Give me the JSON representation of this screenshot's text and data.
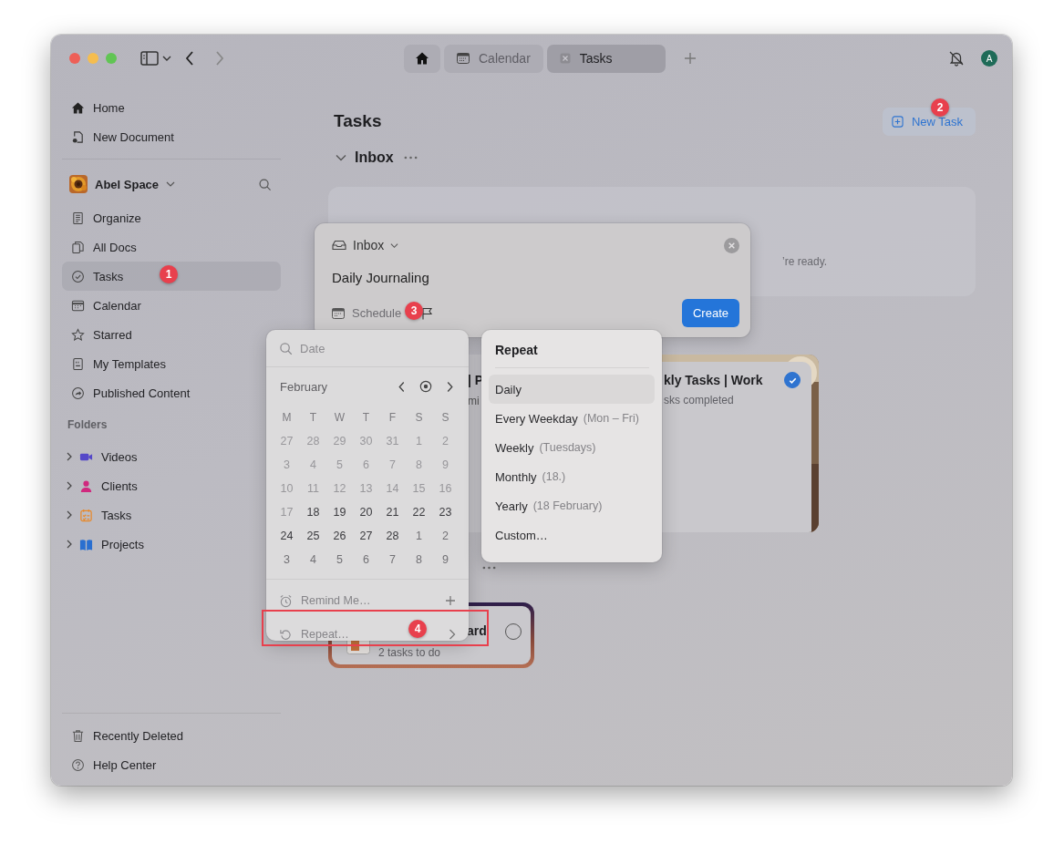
{
  "title_bar": {
    "tabs": [
      {
        "kind": "home",
        "selected": false
      },
      {
        "kind": "page",
        "label": "Calendar",
        "selected": false
      },
      {
        "kind": "page",
        "label": "Tasks",
        "selected": true
      }
    ],
    "avatar": "A"
  },
  "sidebar": {
    "top_items": [
      "Home",
      "New Document"
    ],
    "space": "Abel Space",
    "items": [
      {
        "label": "Organize",
        "selected": false
      },
      {
        "label": "All Docs",
        "selected": false
      },
      {
        "label": "Tasks",
        "selected": true
      },
      {
        "label": "Calendar",
        "selected": false
      },
      {
        "label": "Starred",
        "selected": false
      },
      {
        "label": "My Templates",
        "selected": false
      },
      {
        "label": "Published Content",
        "selected": false
      }
    ],
    "folders_heading": "Folders",
    "folders": [
      {
        "label": "Videos",
        "color": "#5548c8"
      },
      {
        "label": "Clients",
        "color": "#d0287e"
      },
      {
        "label": "Tasks",
        "color": "#e8892a"
      },
      {
        "label": "Projects",
        "color": "#2a6fd0"
      }
    ],
    "bottom_items": [
      "Recently Deleted",
      "Help Center"
    ]
  },
  "main": {
    "title": "Tasks",
    "new_task": "New Task",
    "section": "Inbox",
    "empty_text": "’re ready.",
    "cards": [
      {
        "title": "| P",
        "subtitle": "mi"
      },
      {
        "title": "kly Tasks | Work",
        "subtitle": "sks completed",
        "done": true
      }
    ],
    "bottom_card": {
      "title": "ard",
      "subtitle": "2 tasks to do",
      "done": false
    }
  },
  "new_task_dialog": {
    "list": "Inbox",
    "title": "Daily Journaling",
    "schedule": "Schedule",
    "create": "Create"
  },
  "date_picker": {
    "placeholder": "Date",
    "month": "February",
    "weekdays": [
      "M",
      "T",
      "W",
      "T",
      "F",
      "S",
      "S"
    ],
    "weeks": [
      [
        {
          "day": "27",
          "kind": "past"
        },
        {
          "day": "28",
          "kind": "past"
        },
        {
          "day": "29",
          "kind": "past"
        },
        {
          "day": "30",
          "kind": "past"
        },
        {
          "day": "31",
          "kind": "past"
        },
        {
          "day": "1",
          "kind": "past"
        },
        {
          "day": "2",
          "kind": "past"
        }
      ],
      [
        {
          "day": "3",
          "kind": "past"
        },
        {
          "day": "4",
          "kind": "past"
        },
        {
          "day": "5",
          "kind": "past"
        },
        {
          "day": "6",
          "kind": "past"
        },
        {
          "day": "7",
          "kind": "past"
        },
        {
          "day": "8",
          "kind": "past"
        },
        {
          "day": "9",
          "kind": "past"
        }
      ],
      [
        {
          "day": "10",
          "kind": "past"
        },
        {
          "day": "11",
          "kind": "past"
        },
        {
          "day": "12",
          "kind": "past"
        },
        {
          "day": "13",
          "kind": "past"
        },
        {
          "day": "14",
          "kind": "past"
        },
        {
          "day": "15",
          "kind": "past"
        },
        {
          "day": "16",
          "kind": "past"
        }
      ],
      [
        {
          "day": "17",
          "kind": "past"
        },
        {
          "day": "18",
          "kind": "day"
        },
        {
          "day": "19",
          "kind": "day"
        },
        {
          "day": "20",
          "kind": "day"
        },
        {
          "day": "21",
          "kind": "day"
        },
        {
          "day": "22",
          "kind": "day"
        },
        {
          "day": "23",
          "kind": "day"
        }
      ],
      [
        {
          "day": "24",
          "kind": "day"
        },
        {
          "day": "25",
          "kind": "day"
        },
        {
          "day": "26",
          "kind": "day"
        },
        {
          "day": "27",
          "kind": "day"
        },
        {
          "day": "28",
          "kind": "day"
        },
        {
          "day": "1",
          "kind": "next"
        },
        {
          "day": "2",
          "kind": "next"
        }
      ],
      [
        {
          "day": "3",
          "kind": "next"
        },
        {
          "day": "4",
          "kind": "next"
        },
        {
          "day": "5",
          "kind": "next"
        },
        {
          "day": "6",
          "kind": "next"
        },
        {
          "day": "7",
          "kind": "next"
        },
        {
          "day": "8",
          "kind": "next"
        },
        {
          "day": "9",
          "kind": "next"
        }
      ]
    ],
    "remind": "Remind Me…",
    "repeat": "Repeat…"
  },
  "repeat_menu": {
    "title": "Repeat",
    "options": [
      {
        "label": "Daily",
        "selected": true
      },
      {
        "label": "Every Weekday",
        "hint": "(Mon – Fri)",
        "selected": false
      },
      {
        "label": "Weekly",
        "hint": "(Tuesdays)",
        "selected": false
      },
      {
        "label": "Monthly",
        "hint": "(18.)",
        "selected": false
      },
      {
        "label": "Yearly",
        "hint": "(18 February)",
        "selected": false
      },
      {
        "label": "Custom…",
        "selected": false
      }
    ]
  },
  "annotations": [
    "1",
    "2",
    "3",
    "4"
  ]
}
